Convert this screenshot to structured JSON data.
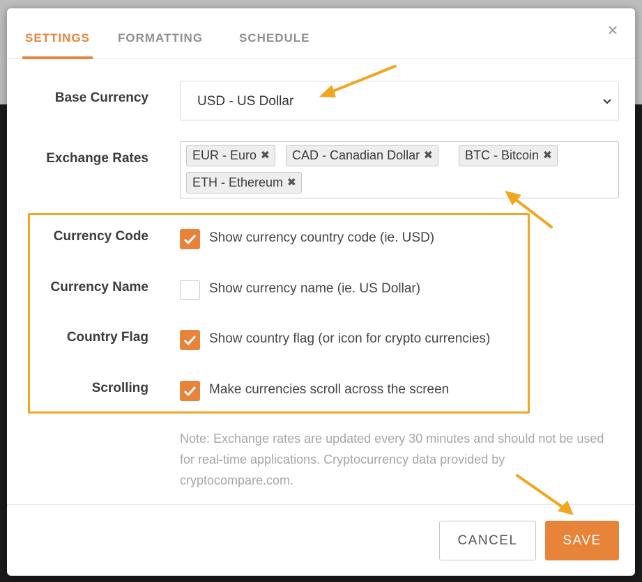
{
  "tabs": [
    {
      "label": "SETTINGS",
      "active": true
    },
    {
      "label": "FORMATTING",
      "active": false
    },
    {
      "label": "SCHEDULE",
      "active": false
    }
  ],
  "close_icon": "×",
  "base_currency": {
    "label": "Base Currency",
    "value": "USD - US Dollar"
  },
  "exchange_rates": {
    "label": "Exchange Rates",
    "chips": [
      "EUR - Euro",
      "CAD - Canadian Dollar",
      "BTC - Bitcoin",
      "ETH - Ethereum"
    ],
    "remove_icon": "✖"
  },
  "options": [
    {
      "label": "Currency Code",
      "text": "Show currency country code (ie. USD)",
      "checked": true
    },
    {
      "label": "Currency Name",
      "text": "Show currency name (ie. US Dollar)",
      "checked": false
    },
    {
      "label": "Country Flag",
      "text": "Show country flag (or icon for crypto currencies)",
      "checked": true
    },
    {
      "label": "Scrolling",
      "text": "Make currencies scroll across the screen",
      "checked": true
    }
  ],
  "note": "Note: Exchange rates are updated every 30 minutes and should not be used for real-time applications. Cryptocurrency data provided by cryptocompare.com.",
  "footer": {
    "cancel_label": "CANCEL",
    "save_label": "SAVE"
  },
  "colors": {
    "accent": "#e8833a",
    "highlight": "#f2a521"
  }
}
